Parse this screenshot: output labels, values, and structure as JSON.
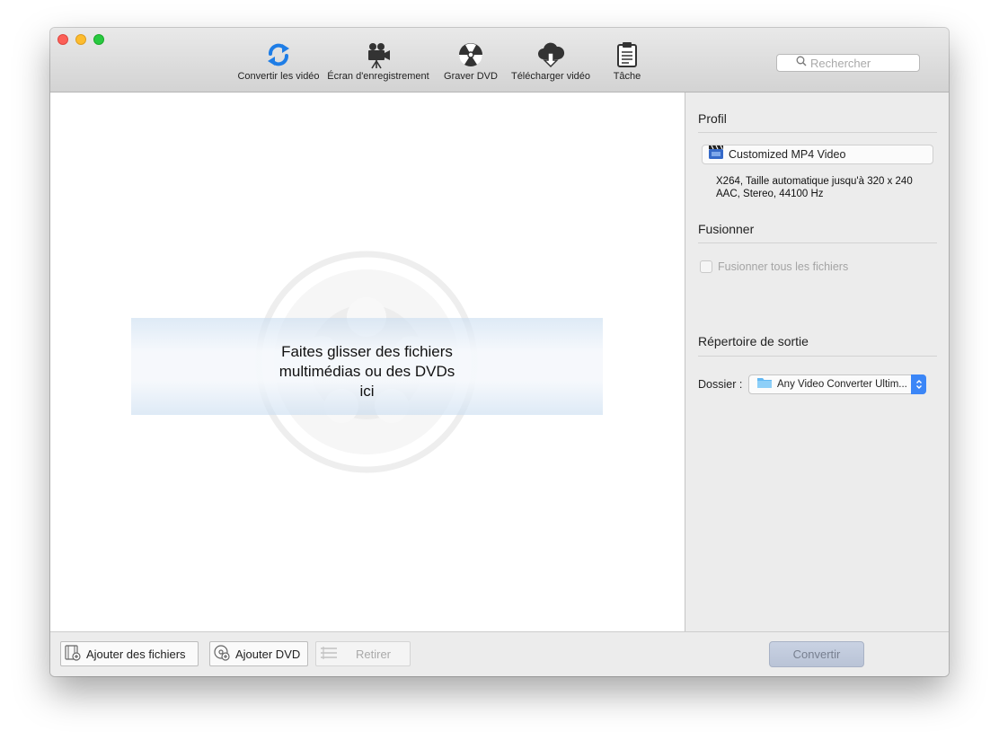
{
  "window": {
    "colors": {
      "accent": "#3b86f7",
      "convert_bg": "#bfc8da"
    }
  },
  "toolbar": {
    "tools": [
      {
        "label": "Convertir les vidéo",
        "icon": "convert-icon"
      },
      {
        "label": "Écran d'enregistrement",
        "icon": "movie-camera-icon"
      },
      {
        "label": "Graver DVD",
        "icon": "burn-disc-icon"
      },
      {
        "label": "Télécharger vidéo",
        "icon": "cloud-download-icon"
      },
      {
        "label": "Tâche",
        "icon": "clipboard-icon"
      }
    ],
    "search_placeholder": "Rechercher"
  },
  "drop": {
    "text_lines": [
      "Faites glisser des fichiers",
      "multimédias ou des DVDs",
      "ici"
    ]
  },
  "panel": {
    "profile_title": "Profil",
    "profile_value": "Customized MP4 Video",
    "profile_desc": [
      "X264, Taille automatique jusqu'à 320 x 240",
      "AAC, Stereo, 44100 Hz"
    ],
    "merge_title": "Fusionner",
    "merge_label": "Fusionner tous les fichiers",
    "output_title": "Répertoire de sortie",
    "folder_label": "Dossier :",
    "folder_value": "Any Video Converter Ultim..."
  },
  "bottom": {
    "add_files": "Ajouter des fichiers",
    "add_dvd": "Ajouter DVD",
    "remove": "Retirer",
    "convert": "Convertir"
  }
}
